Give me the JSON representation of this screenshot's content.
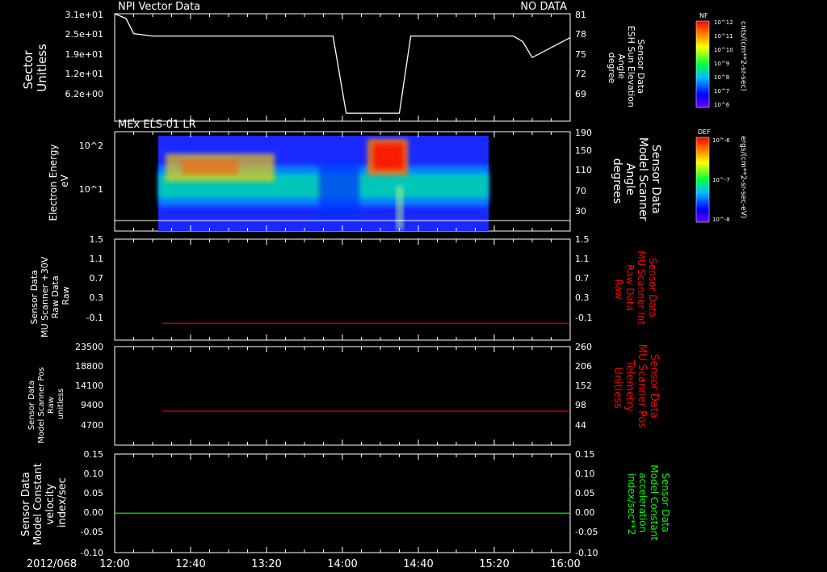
{
  "x_axis": {
    "date_label": "2012/068",
    "ticks": [
      "12:00",
      "12:40",
      "13:20",
      "14:00",
      "14:40",
      "15:20",
      "16:00"
    ],
    "range": [
      "12:00",
      "16:00"
    ]
  },
  "chart_data": [
    {
      "type": "line",
      "title": "NPI Vector Data",
      "status": "NO DATA",
      "ylabel_left": [
        "Sector",
        "Unitless"
      ],
      "yticks_left": [
        "3.1e+01",
        "2.5e+01",
        "1.9e+01",
        "1.2e+01",
        "6.2e+00"
      ],
      "ylabel_right": [
        "Sensor Data",
        "ESH Sun Elevation",
        "Angle",
        "degree"
      ],
      "yticks_right": [
        "81",
        "78",
        "75",
        "72",
        "69"
      ],
      "ylim_right": [
        67.5,
        81
      ],
      "series": [
        {
          "color": "#ffffff",
          "points": [
            [
              "12:00",
              81
            ],
            [
              "12:06",
              80.4
            ],
            [
              "12:10",
              78.5
            ],
            [
              "12:20",
              78.2
            ],
            [
              "13:40",
              78.2
            ],
            [
              "13:55",
              78.2
            ],
            [
              "14:02",
              68.5
            ],
            [
              "14:30",
              68.5
            ],
            [
              "14:36",
              78.2
            ],
            [
              "15:30",
              78.2
            ],
            [
              "15:35",
              77.5
            ],
            [
              "15:40",
              75.5
            ],
            [
              "16:00",
              78.0
            ]
          ]
        }
      ],
      "colorbar": {
        "label": "NF",
        "units": "cnts/(cm**2-sr-sec)",
        "ticks": [
          "10^12",
          "10^11",
          "10^10",
          "10^9",
          "10^8",
          "10^7",
          "10^6"
        ]
      }
    },
    {
      "type": "heatmap",
      "title": "MEx ELS-01 LR",
      "ylabel_left": [
        "Electron Energy",
        "eV"
      ],
      "yticks_left": [
        "10^2",
        "10^1"
      ],
      "ylabel_right": [
        "Sensor Data",
        "Model Scanner",
        "Angle",
        "degrees"
      ],
      "yticks_right": [
        "190",
        "150",
        "110",
        "70",
        "30"
      ],
      "data_x_range": [
        "12:35",
        "15:20"
      ],
      "features": [
        {
          "x": [
            "12:35",
            "13:35"
          ],
          "desc": "enhanced flux near 30 eV"
        },
        {
          "x": [
            "14:20",
            "14:35"
          ],
          "desc": "strong flux up to 100 eV"
        }
      ],
      "overlay_line": {
        "color": "#ffffff",
        "value_deg": 10
      },
      "colorbar": {
        "label": "DEF",
        "units": "ergs/(cm**2-sr-sec-eV)",
        "ticks": [
          "10^-6",
          "10^-7",
          "10^-8"
        ]
      }
    },
    {
      "type": "line",
      "ylabel_left": [
        "Sensor Data",
        "MU Scanner +30V",
        "Raw Data",
        "Raw"
      ],
      "yticks_left": [
        "1.5",
        "1.1",
        "0.7",
        "0.3",
        "-0.1"
      ],
      "ylabel_right": [
        "Sensor Data",
        "MU Scanner Int",
        "Raw Data",
        "Raw"
      ],
      "yticks_right": [
        "1.5",
        "1.1",
        "0.7",
        "0.3",
        "-0.1"
      ],
      "ylim": [
        -0.3,
        1.5
      ],
      "series": [
        {
          "color": "#ff0000",
          "x": [
            "12:25",
            "16:00"
          ],
          "value": 0.0
        }
      ]
    },
    {
      "type": "line",
      "ylabel_left": [
        "Sensor Data",
        "Model Scanner Pos",
        "Raw",
        "unitless"
      ],
      "yticks_left": [
        "23500",
        "18800",
        "14100",
        "9400",
        "4700"
      ],
      "ylabel_right": [
        "Sensor Data",
        "MU Scanner Pos",
        "Telemetry",
        "Unitless"
      ],
      "yticks_right": [
        "260",
        "206",
        "152",
        "98",
        "44"
      ],
      "ylim": [
        0,
        23500
      ],
      "series": [
        {
          "color": "#ff0000",
          "x": [
            "12:25",
            "16:00"
          ],
          "value": 8100
        }
      ]
    },
    {
      "type": "line",
      "ylabel_left": [
        "Sensor Data",
        "Model Constant",
        "velocity",
        "index/sec"
      ],
      "yticks_left": [
        "0.15",
        "0.10",
        "0.05",
        "0.00",
        "-0.05",
        "-0.10"
      ],
      "ylabel_right": [
        "Sensor Data",
        "Model Constant",
        "acceleration",
        "index/sec**2"
      ],
      "yticks_right": [
        "0.15",
        "0.10",
        "0.05",
        "0.00",
        "-0.05",
        "-0.10"
      ],
      "ylim": [
        -0.1,
        0.15
      ],
      "series": [
        {
          "color": "#00ff00",
          "x": [
            "12:00",
            "16:00"
          ],
          "value": 0.0
        }
      ]
    }
  ],
  "colors": {
    "red_label": "#ff0000",
    "green_label": "#00ff00"
  }
}
